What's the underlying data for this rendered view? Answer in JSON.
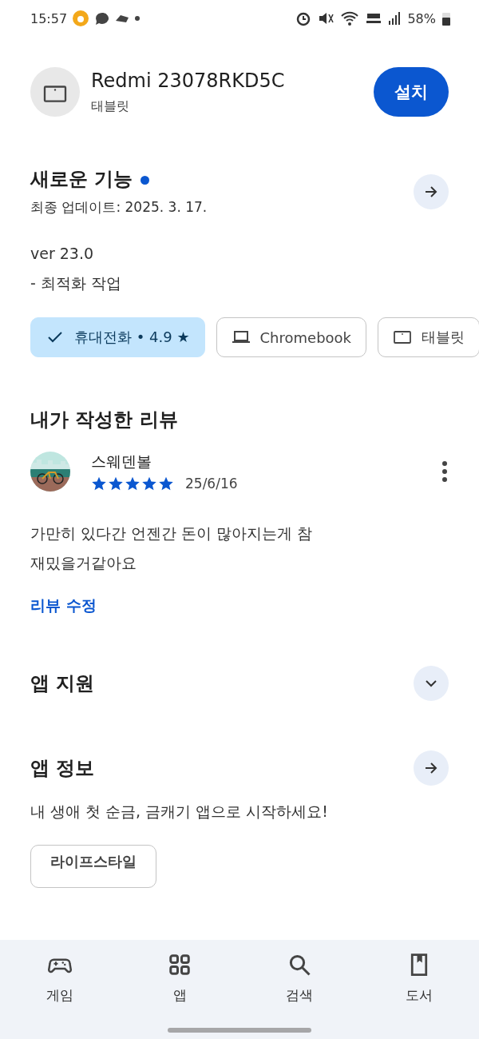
{
  "status_bar": {
    "time": "15:57",
    "battery": "58%"
  },
  "app": {
    "name": "Redmi 23078RKD5C",
    "device": "태블릿",
    "install_button": "설치"
  },
  "whats_new": {
    "title": "새로운 기능",
    "updated": "최종 업데이트: 2025. 3. 17.",
    "notes": [
      "ver 23.0",
      "- 최적화 작업"
    ]
  },
  "device_chips": [
    {
      "kind": "phone",
      "label": "휴대전화 • 4.9 ★",
      "selected": true
    },
    {
      "kind": "laptop",
      "label": "Chromebook",
      "selected": false
    },
    {
      "kind": "tablet",
      "label": "태블릿",
      "selected": false
    }
  ],
  "my_review": {
    "title": "내가 작성한 리뷰",
    "author": "스웨덴볼",
    "stars": 5,
    "date": "25/6/16",
    "text": "가만히 있다간 언젠간 돈이 많아지는게 참\n재밌을거같아요",
    "edit_link": "리뷰 수정"
  },
  "app_support": {
    "title": "앱 지원"
  },
  "app_info": {
    "title": "앱 정보",
    "description": "내 생애 첫 순금, 금캐기 앱으로 시작하세요!",
    "tags": [
      "라이프스타일"
    ]
  },
  "bottom_nav": [
    {
      "kind": "games",
      "label": "게임"
    },
    {
      "kind": "apps",
      "label": "앱"
    },
    {
      "kind": "search",
      "label": "검색"
    },
    {
      "kind": "books",
      "label": "도서"
    }
  ]
}
